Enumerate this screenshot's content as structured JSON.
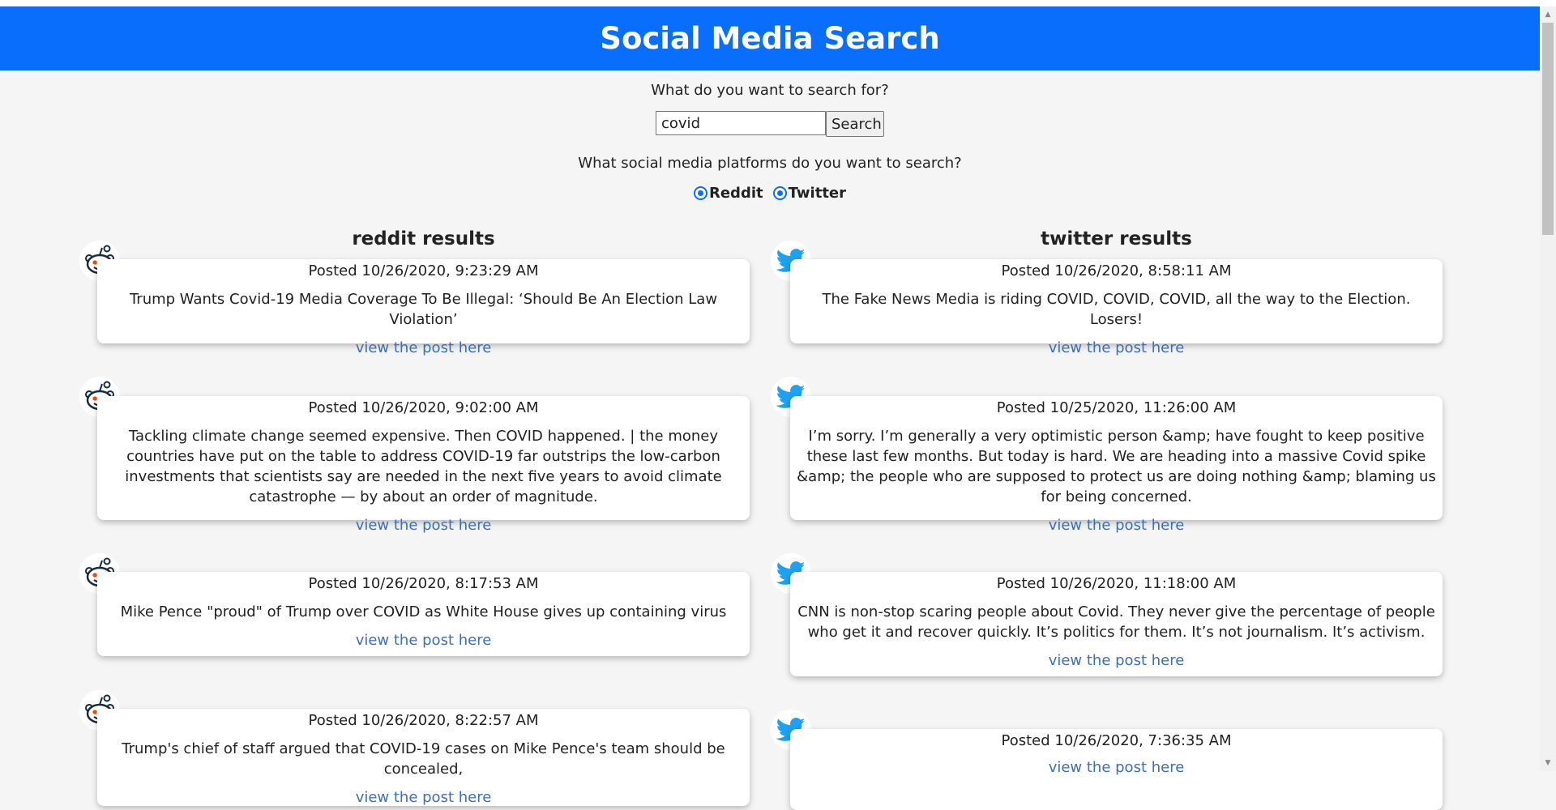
{
  "header": {
    "title": "Social Media Search"
  },
  "search": {
    "prompt": "What do you want to search for?",
    "value": "covid",
    "button_label": "Search",
    "platform_prompt": "What social media platforms do you want to search?",
    "platforms": [
      {
        "label": "Reddit",
        "selected": true
      },
      {
        "label": "Twitter",
        "selected": true
      }
    ]
  },
  "reddit": {
    "title": "reddit results",
    "posts": [
      {
        "posted": "Posted 10/26/2020, 9:23:29 AM",
        "text": "Trump Wants Covid-19 Media Coverage To Be Illegal: ‘Should Be An Election Law Violation’",
        "link": "view the post here"
      },
      {
        "posted": "Posted 10/26/2020, 9:02:00 AM",
        "text": "Tackling climate change seemed expensive. Then COVID happened. | the money countries have put on the table to address COVID-19 far outstrips the low-carbon investments that scientists say are needed in the next five years to avoid climate catastrophe — by about an order of magnitude.",
        "link": "view the post here"
      },
      {
        "posted": "Posted 10/26/2020, 8:17:53 AM",
        "text": "Mike Pence \"proud\" of Trump over COVID as White House gives up containing virus",
        "link": "view the post here"
      },
      {
        "posted": "Posted 10/26/2020, 8:22:57 AM",
        "text": "Trump's chief of staff argued that COVID-19 cases on Mike Pence's team should be concealed,",
        "link": "view the post here"
      }
    ]
  },
  "twitter": {
    "title": "twitter results",
    "posts": [
      {
        "posted": "Posted 10/26/2020, 8:58:11 AM",
        "text": "The Fake News Media is riding COVID, COVID, COVID, all the way to the Election. Losers!",
        "link": "view the post here"
      },
      {
        "posted": "Posted 10/25/2020, 11:26:00 AM",
        "text": "I’m sorry. I’m generally a very optimistic person &amp; have fought to keep positive these last few months. But today is hard. We are heading into a massive Covid spike &amp; the people who are supposed to protect us are doing nothing &amp; blaming us for being concerned.",
        "link": "view the post here"
      },
      {
        "posted": "Posted 10/26/2020, 11:18:00 AM",
        "text": "CNN is non-stop scaring people about Covid. They never give the percentage of people who get it and recover quickly. It’s politics for them. It’s not journalism. It’s activism.",
        "link": "view the post here"
      },
      {
        "posted": "Posted 10/26/2020, 7:36:35 AM",
        "text": "",
        "link": "view the post here"
      }
    ]
  },
  "colors": {
    "header": "#0a6efc",
    "link": "#3c6fb5",
    "twitter": "#1da1f2",
    "reddit_eyes": "#ff4500"
  },
  "icons": {
    "reddit": "reddit-icon",
    "twitter": "twitter-icon"
  }
}
